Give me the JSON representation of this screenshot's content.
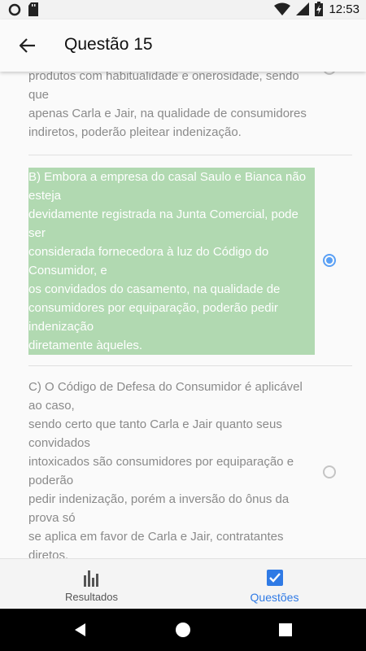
{
  "status_bar": {
    "time": "12:53",
    "icons": [
      "circle-notification-icon",
      "sd-card-icon",
      "wifi-icon",
      "signal-icon",
      "battery-charging-icon"
    ]
  },
  "app_bar": {
    "title": "Questão 15",
    "back_icon": "arrow-back-icon"
  },
  "question": {
    "options": [
      {
        "text": "produtos com habitualidade e onerosidade, sendo\nque\napenas Carla e Jair, na qualidade de consumidores\nindiretos, poderão pleitear indenização.",
        "selected": false
      },
      {
        "text": "B) Embora a empresa do casal Saulo e Bianca não\nesteja\ndevidamente registrada na Junta Comercial, pode\nser\nconsiderada fornecedora à luz do Código do\nConsumidor, e\nos convidados do casamento, na qualidade de\nconsumidores por equiparação, poderão pedir\nindenização\ndiretamente àqueles.",
        "selected": true
      },
      {
        "text": "C) O Código de Defesa do Consumidor é aplicável\nao caso,\nsendo certo que tanto Carla e Jair quanto seus\nconvidados\nintoxicados são consumidores por equiparação e\npoderão\npedir indenização, porém a inversão do ônus da\nprova só\nse aplica em favor de Carla e Jair, contratantes\ndiretos.",
        "selected": false
      }
    ]
  },
  "bottom_nav": {
    "items": [
      {
        "label": "Resultados",
        "icon": "bar-chart-icon",
        "active": false
      },
      {
        "label": "Questões",
        "icon": "checkbox-checked-icon",
        "active": true
      }
    ]
  },
  "colors": {
    "accent": "#2f7ae5",
    "radio_selected": "#5aa0f5",
    "selected_highlight": "#b1d9b1",
    "option_text": "#8a8a8a"
  }
}
